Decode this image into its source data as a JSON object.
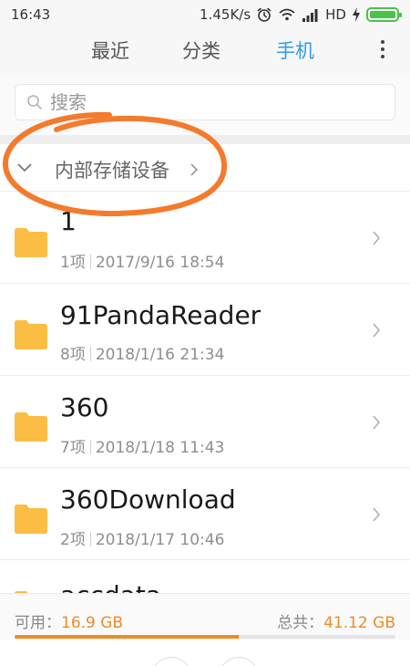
{
  "status_bar": {
    "time": "16:43",
    "speed": "1.45K/s",
    "network": "HD",
    "icons": [
      "alarm-icon",
      "wifi-icon",
      "signal-icon",
      "charging-icon",
      "battery-icon"
    ],
    "battery_level": 1.0
  },
  "tabs": [
    {
      "label": "最近",
      "active": false
    },
    {
      "label": "分类",
      "active": false
    },
    {
      "label": "手机",
      "active": true
    }
  ],
  "search": {
    "placeholder": "搜索"
  },
  "breadcrumb": {
    "label": "内部存储设备"
  },
  "files": [
    {
      "name": "1",
      "count": "1项",
      "date": "2017/9/16 18:54"
    },
    {
      "name": "91PandaReader",
      "count": "8项",
      "date": "2018/1/16 21:34"
    },
    {
      "name": "360",
      "count": "7项",
      "date": "2018/1/18 11:43"
    },
    {
      "name": "360Download",
      "count": "2项",
      "date": "2018/1/17 10:46"
    },
    {
      "name": "accdata",
      "count": "",
      "date": ""
    }
  ],
  "storage": {
    "available_label": "可用：",
    "available_value": "16.9 GB",
    "total_label": "总共：",
    "total_value": "41.12 GB",
    "used_fraction": 0.589
  },
  "colors": {
    "accent_blue": "#2f9ce8",
    "folder": "#fbbd44",
    "storage_orange": "#f08a24",
    "annotation": "#f47a2c",
    "battery": "#4ac34a"
  }
}
